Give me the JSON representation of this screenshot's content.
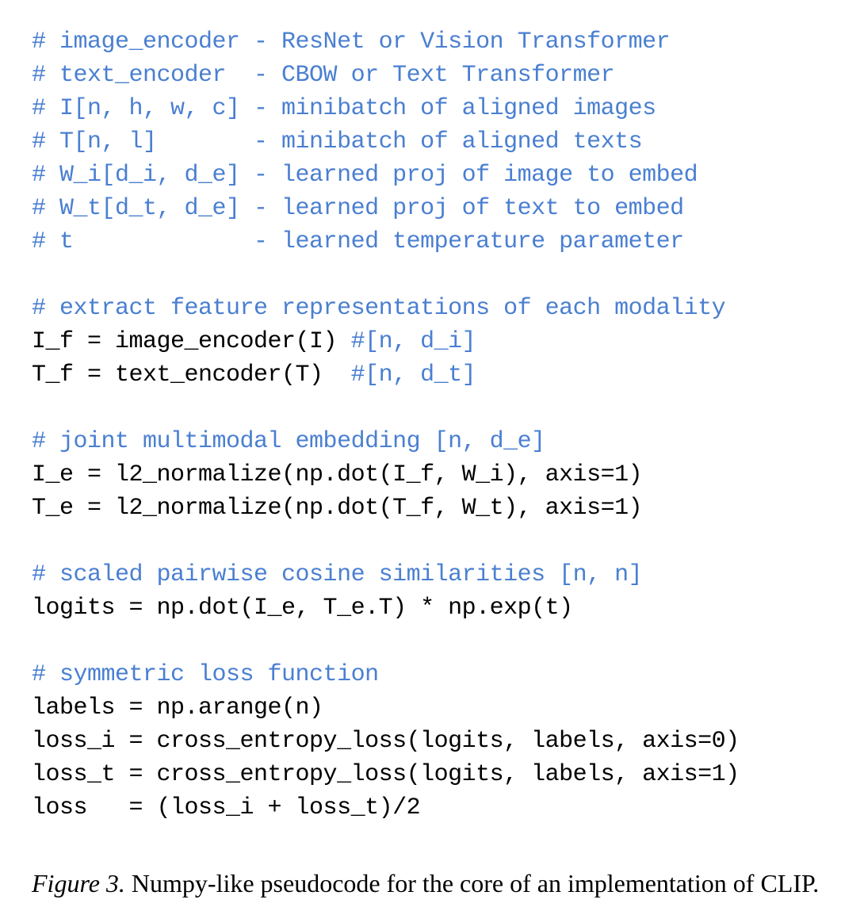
{
  "code": {
    "lines": [
      {
        "segments": [
          {
            "text": "# image_encoder - ResNet or Vision Transformer",
            "comment": true
          }
        ]
      },
      {
        "segments": [
          {
            "text": "# text_encoder  - CBOW or Text Transformer",
            "comment": true
          }
        ]
      },
      {
        "segments": [
          {
            "text": "# I[n, h, w, c] - minibatch of aligned images",
            "comment": true
          }
        ]
      },
      {
        "segments": [
          {
            "text": "# T[n, l]       - minibatch of aligned texts",
            "comment": true
          }
        ]
      },
      {
        "segments": [
          {
            "text": "# W_i[d_i, d_e] - learned proj of image to embed",
            "comment": true
          }
        ]
      },
      {
        "segments": [
          {
            "text": "# W_t[d_t, d_e] - learned proj of text to embed",
            "comment": true
          }
        ]
      },
      {
        "segments": [
          {
            "text": "# t             - learned temperature parameter",
            "comment": true
          }
        ]
      },
      {
        "segments": [
          {
            "text": "",
            "comment": false
          }
        ]
      },
      {
        "segments": [
          {
            "text": "# extract feature representations of each modality",
            "comment": true
          }
        ]
      },
      {
        "segments": [
          {
            "text": "I_f = image_encoder(I) ",
            "comment": false
          },
          {
            "text": "#[n, d_i]",
            "comment": true
          }
        ]
      },
      {
        "segments": [
          {
            "text": "T_f = text_encoder(T)  ",
            "comment": false
          },
          {
            "text": "#[n, d_t]",
            "comment": true
          }
        ]
      },
      {
        "segments": [
          {
            "text": "",
            "comment": false
          }
        ]
      },
      {
        "segments": [
          {
            "text": "# joint multimodal embedding [n, d_e]",
            "comment": true
          }
        ]
      },
      {
        "segments": [
          {
            "text": "I_e = l2_normalize(np.dot(I_f, W_i), axis=1)",
            "comment": false
          }
        ]
      },
      {
        "segments": [
          {
            "text": "T_e = l2_normalize(np.dot(T_f, W_t), axis=1)",
            "comment": false
          }
        ]
      },
      {
        "segments": [
          {
            "text": "",
            "comment": false
          }
        ]
      },
      {
        "segments": [
          {
            "text": "# scaled pairwise cosine similarities [n, n]",
            "comment": true
          }
        ]
      },
      {
        "segments": [
          {
            "text": "logits = np.dot(I_e, T_e.T) * np.exp(t)",
            "comment": false
          }
        ]
      },
      {
        "segments": [
          {
            "text": "",
            "comment": false
          }
        ]
      },
      {
        "segments": [
          {
            "text": "# symmetric loss function",
            "comment": true
          }
        ]
      },
      {
        "segments": [
          {
            "text": "labels = np.arange(n)",
            "comment": false
          }
        ]
      },
      {
        "segments": [
          {
            "text": "loss_i = cross_entropy_loss(logits, labels, axis=0)",
            "comment": false
          }
        ]
      },
      {
        "segments": [
          {
            "text": "loss_t = cross_entropy_loss(logits, labels, axis=1)",
            "comment": false
          }
        ]
      },
      {
        "segments": [
          {
            "text": "loss   = (loss_i + loss_t)/2",
            "comment": false
          }
        ]
      }
    ]
  },
  "caption": {
    "label": "Figure 3.",
    "text": " Numpy-like pseudocode for the core of an implementation of CLIP."
  }
}
